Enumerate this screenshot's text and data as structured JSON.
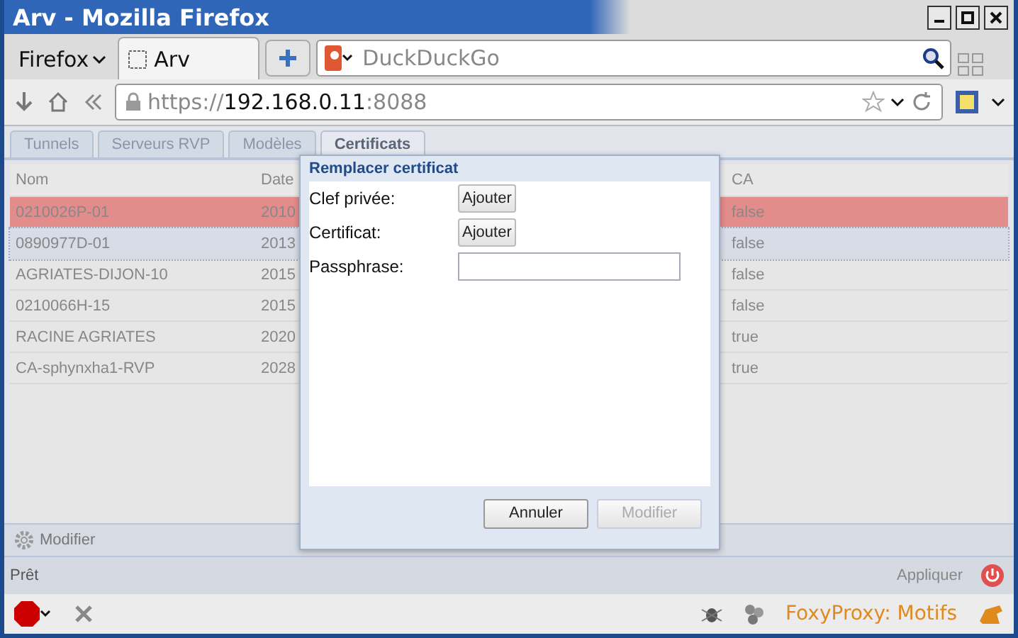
{
  "window": {
    "title": "Arv - Mozilla Firefox"
  },
  "browser": {
    "menu_label": "Firefox",
    "tabs": [
      {
        "label": "Arv",
        "selected": true
      }
    ],
    "search": {
      "placeholder": "DuckDuckGo"
    },
    "url": {
      "scheme": "https://",
      "host": "192.168.0.11",
      "port": ":8088"
    }
  },
  "app_tabs": [
    {
      "label": "Tunnels",
      "selected": false
    },
    {
      "label": "Serveurs RVP",
      "selected": false
    },
    {
      "label": "Modèles",
      "selected": false
    },
    {
      "label": "Certificats",
      "selected": true
    }
  ],
  "table": {
    "columns": [
      "Nom",
      "Date",
      "CA"
    ],
    "rows": [
      {
        "cells": [
          "0210026P-01",
          "2010",
          "false"
        ],
        "selected": true,
        "focused": false
      },
      {
        "cells": [
          "0890977D-01",
          "2013",
          "false"
        ],
        "selected": false,
        "focused": true
      },
      {
        "cells": [
          "AGRIATES-DIJON-10",
          "2015",
          "false"
        ],
        "selected": false,
        "focused": false
      },
      {
        "cells": [
          "0210066H-15",
          "2015",
          "false"
        ],
        "selected": false,
        "focused": false
      },
      {
        "cells": [
          "RACINE AGRIATES",
          "2020",
          "true"
        ],
        "selected": false,
        "focused": false
      },
      {
        "cells": [
          "CA-sphynxha1-RVP",
          "2028",
          "true"
        ],
        "selected": false,
        "focused": false
      }
    ]
  },
  "toolbar": {
    "button": {
      "label": "Modifier",
      "disabled": true
    }
  },
  "status_bar": {
    "text": "Prêt",
    "apply": "Appliquer"
  },
  "dialog": {
    "title": "Remplacer certificat",
    "fields": [
      {
        "kind": "file",
        "label": "Clef privée:",
        "button": "Ajouter"
      },
      {
        "kind": "file",
        "label": "Certificat:",
        "button": "Ajouter"
      },
      {
        "kind": "password",
        "label": "Passphrase:"
      }
    ],
    "buttons": [
      {
        "label": "Annuler",
        "disabled": false
      },
      {
        "label": "Modifier",
        "disabled": true
      }
    ]
  },
  "addon_bar": {
    "proxy": "FoxyProxy: Motifs"
  }
}
